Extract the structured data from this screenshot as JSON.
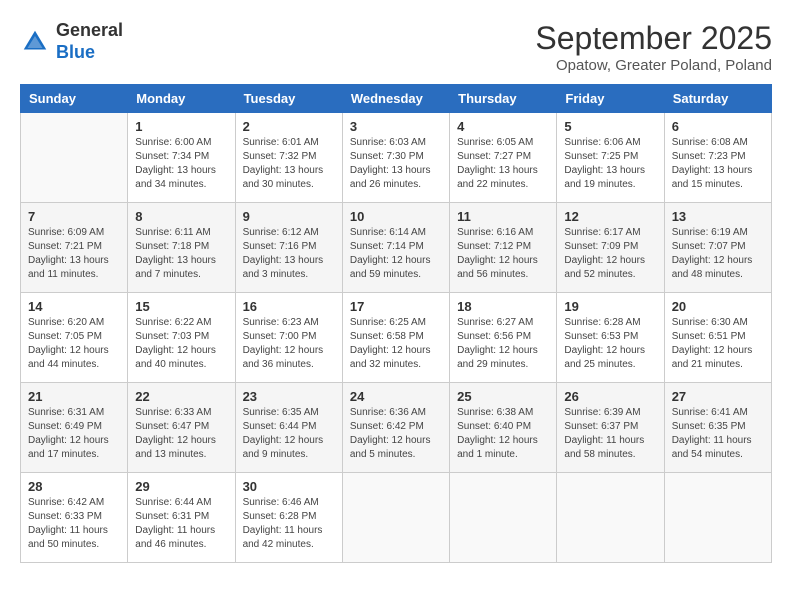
{
  "header": {
    "logo": {
      "general": "General",
      "blue": "Blue"
    },
    "title": "September 2025",
    "subtitle": "Opatow, Greater Poland, Poland"
  },
  "days_of_week": [
    "Sunday",
    "Monday",
    "Tuesday",
    "Wednesday",
    "Thursday",
    "Friday",
    "Saturday"
  ],
  "weeks": [
    [
      {
        "day": "",
        "empty": true
      },
      {
        "day": "1",
        "sunrise": "6:00 AM",
        "sunset": "7:34 PM",
        "daylight": "13 hours and 34 minutes."
      },
      {
        "day": "2",
        "sunrise": "6:01 AM",
        "sunset": "7:32 PM",
        "daylight": "13 hours and 30 minutes."
      },
      {
        "day": "3",
        "sunrise": "6:03 AM",
        "sunset": "7:30 PM",
        "daylight": "13 hours and 26 minutes."
      },
      {
        "day": "4",
        "sunrise": "6:05 AM",
        "sunset": "7:27 PM",
        "daylight": "13 hours and 22 minutes."
      },
      {
        "day": "5",
        "sunrise": "6:06 AM",
        "sunset": "7:25 PM",
        "daylight": "13 hours and 19 minutes."
      },
      {
        "day": "6",
        "sunrise": "6:08 AM",
        "sunset": "7:23 PM",
        "daylight": "13 hours and 15 minutes."
      }
    ],
    [
      {
        "day": "7",
        "sunrise": "6:09 AM",
        "sunset": "7:21 PM",
        "daylight": "13 hours and 11 minutes."
      },
      {
        "day": "8",
        "sunrise": "6:11 AM",
        "sunset": "7:18 PM",
        "daylight": "13 hours and 7 minutes."
      },
      {
        "day": "9",
        "sunrise": "6:12 AM",
        "sunset": "7:16 PM",
        "daylight": "13 hours and 3 minutes."
      },
      {
        "day": "10",
        "sunrise": "6:14 AM",
        "sunset": "7:14 PM",
        "daylight": "12 hours and 59 minutes."
      },
      {
        "day": "11",
        "sunrise": "6:16 AM",
        "sunset": "7:12 PM",
        "daylight": "12 hours and 56 minutes."
      },
      {
        "day": "12",
        "sunrise": "6:17 AM",
        "sunset": "7:09 PM",
        "daylight": "12 hours and 52 minutes."
      },
      {
        "day": "13",
        "sunrise": "6:19 AM",
        "sunset": "7:07 PM",
        "daylight": "12 hours and 48 minutes."
      }
    ],
    [
      {
        "day": "14",
        "sunrise": "6:20 AM",
        "sunset": "7:05 PM",
        "daylight": "12 hours and 44 minutes."
      },
      {
        "day": "15",
        "sunrise": "6:22 AM",
        "sunset": "7:03 PM",
        "daylight": "12 hours and 40 minutes."
      },
      {
        "day": "16",
        "sunrise": "6:23 AM",
        "sunset": "7:00 PM",
        "daylight": "12 hours and 36 minutes."
      },
      {
        "day": "17",
        "sunrise": "6:25 AM",
        "sunset": "6:58 PM",
        "daylight": "12 hours and 32 minutes."
      },
      {
        "day": "18",
        "sunrise": "6:27 AM",
        "sunset": "6:56 PM",
        "daylight": "12 hours and 29 minutes."
      },
      {
        "day": "19",
        "sunrise": "6:28 AM",
        "sunset": "6:53 PM",
        "daylight": "12 hours and 25 minutes."
      },
      {
        "day": "20",
        "sunrise": "6:30 AM",
        "sunset": "6:51 PM",
        "daylight": "12 hours and 21 minutes."
      }
    ],
    [
      {
        "day": "21",
        "sunrise": "6:31 AM",
        "sunset": "6:49 PM",
        "daylight": "12 hours and 17 minutes."
      },
      {
        "day": "22",
        "sunrise": "6:33 AM",
        "sunset": "6:47 PM",
        "daylight": "12 hours and 13 minutes."
      },
      {
        "day": "23",
        "sunrise": "6:35 AM",
        "sunset": "6:44 PM",
        "daylight": "12 hours and 9 minutes."
      },
      {
        "day": "24",
        "sunrise": "6:36 AM",
        "sunset": "6:42 PM",
        "daylight": "12 hours and 5 minutes."
      },
      {
        "day": "25",
        "sunrise": "6:38 AM",
        "sunset": "6:40 PM",
        "daylight": "12 hours and 1 minute."
      },
      {
        "day": "26",
        "sunrise": "6:39 AM",
        "sunset": "6:37 PM",
        "daylight": "11 hours and 58 minutes."
      },
      {
        "day": "27",
        "sunrise": "6:41 AM",
        "sunset": "6:35 PM",
        "daylight": "11 hours and 54 minutes."
      }
    ],
    [
      {
        "day": "28",
        "sunrise": "6:42 AM",
        "sunset": "6:33 PM",
        "daylight": "11 hours and 50 minutes."
      },
      {
        "day": "29",
        "sunrise": "6:44 AM",
        "sunset": "6:31 PM",
        "daylight": "11 hours and 46 minutes."
      },
      {
        "day": "30",
        "sunrise": "6:46 AM",
        "sunset": "6:28 PM",
        "daylight": "11 hours and 42 minutes."
      },
      {
        "day": "",
        "empty": true
      },
      {
        "day": "",
        "empty": true
      },
      {
        "day": "",
        "empty": true
      },
      {
        "day": "",
        "empty": true
      }
    ]
  ]
}
